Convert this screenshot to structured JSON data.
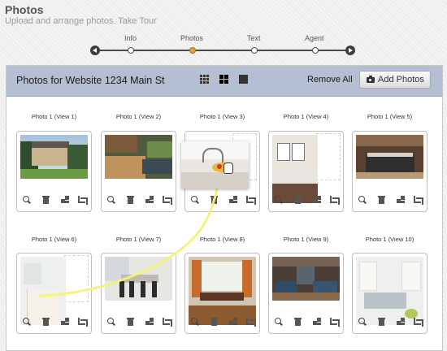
{
  "header": {
    "title": "Photos",
    "subtitle": "Upload and arrange photos.",
    "tour_link": "Take Tour"
  },
  "stepper": {
    "steps": [
      {
        "label": "Info",
        "state": "done"
      },
      {
        "label": "Photos",
        "state": "active"
      },
      {
        "label": "Text",
        "state": "todo"
      },
      {
        "label": "Agent",
        "state": "todo"
      }
    ]
  },
  "panel": {
    "title": "Photos for Website 1234 Main St",
    "remove_all_label": "Remove All",
    "add_photos_label": "Add Photos",
    "view_modes": [
      "grid-small-icon",
      "grid-large-icon",
      "single-icon"
    ],
    "selected_view_mode": "grid-large-icon"
  },
  "photos": [
    {
      "label": "Photo 1 (View 1)",
      "scene": "house-exterior"
    },
    {
      "label": "Photo 1 (View 2)",
      "scene": "deck-patio"
    },
    {
      "label": "Photo 1 (View 3)",
      "scene": "empty-drop-target"
    },
    {
      "label": "Photo 1 (View 4)",
      "scene": "bedroom"
    },
    {
      "label": "Photo 1 (View 5)",
      "scene": "kitchen"
    },
    {
      "label": "Photo 1 (View 6)",
      "scene": "white-kitchen-drop-target"
    },
    {
      "label": "Photo 1 (View 7)",
      "scene": "dining-room-white"
    },
    {
      "label": "Photo 1 (View 8)",
      "scene": "dining-room-wood"
    },
    {
      "label": "Photo 1 (View 9)",
      "scene": "living-room-fireplace"
    },
    {
      "label": "Photo 1 (View 10)",
      "scene": "living-room-white"
    }
  ],
  "tools": [
    "zoom-icon",
    "trash-icon",
    "arrange-icon",
    "crop-icon"
  ],
  "drag": {
    "dragged_scene": "kitchen-sink-fruit-bowl",
    "cursor": "hand-grab-icon",
    "accent": "#f2f27a"
  }
}
